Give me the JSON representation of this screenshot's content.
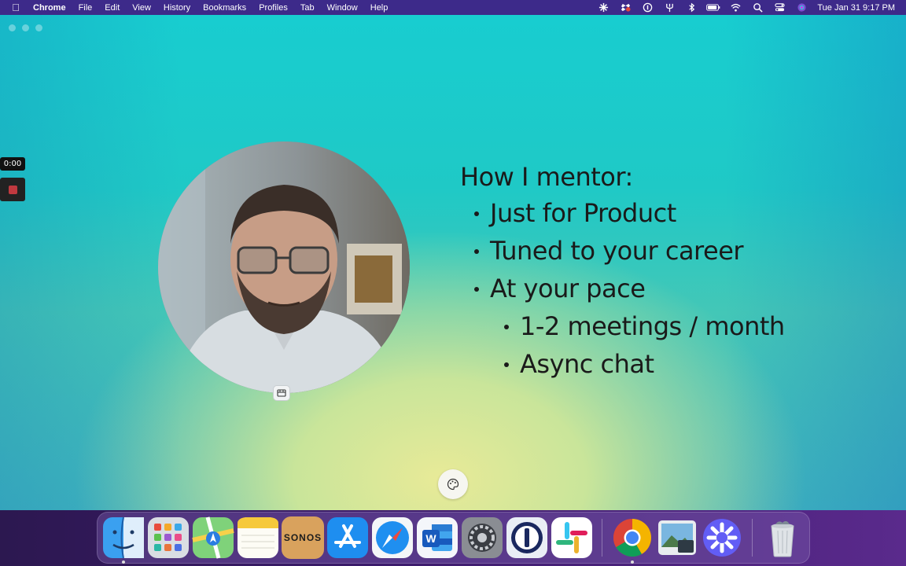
{
  "menubar": {
    "app_name": "Chrome",
    "items": [
      "File",
      "Edit",
      "View",
      "History",
      "Bookmarks",
      "Profiles",
      "Tab",
      "Window",
      "Help"
    ],
    "clock": "Tue Jan 31  9:17 PM"
  },
  "recorder": {
    "timer": "0:00"
  },
  "slide": {
    "heading": "How I mentor:",
    "bullets": [
      {
        "text": "Just for Product",
        "level": 1
      },
      {
        "text": "Tuned to your career",
        "level": 1
      },
      {
        "text": "At your pace",
        "level": 1
      },
      {
        "text": "1-2 meetings / month",
        "level": 2
      },
      {
        "text": "Async chat",
        "level": 2
      }
    ]
  },
  "dock": {
    "sonos_label": "SONOS",
    "apps": [
      "finder-icon",
      "launchpad-icon",
      "maps-icon",
      "notes-icon",
      "sonos-icon",
      "app-store-icon",
      "safari-icon",
      "word-icon",
      "system-settings-icon",
      "1password-icon",
      "slack-icon",
      "chrome-icon",
      "preview-icon",
      "loom-icon",
      "trash-icon"
    ]
  },
  "colors": {
    "menubar": "#3d2a8a",
    "recording_red": "#c0393f",
    "stage_teal": "#1fc9c6",
    "stage_yellow": "#e8ea98"
  }
}
